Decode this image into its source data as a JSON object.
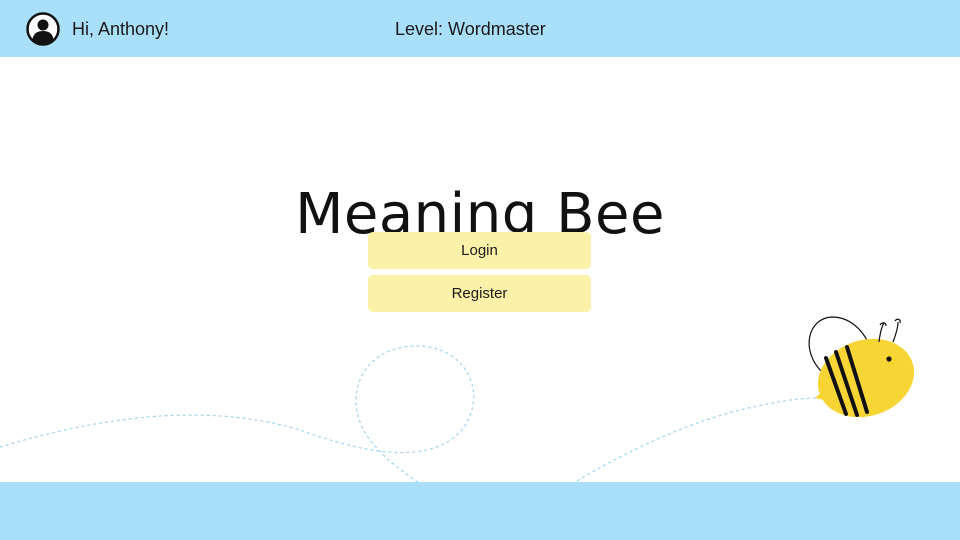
{
  "header": {
    "avatar_icon": "user-avatar-icon",
    "greeting": "Hi, Anthony!",
    "level": "Level: Wordmaster"
  },
  "main": {
    "title": "Meaning Bee",
    "login_label": "Login",
    "register_label": "Register"
  },
  "decorations": {
    "mascot": "bee-icon",
    "flight_path": "dashed-flight-path"
  },
  "colors": {
    "bar": "#aadff9",
    "button": "#fbf1a9",
    "bee_body": "#f7d535",
    "path": "#9fd4ef"
  }
}
